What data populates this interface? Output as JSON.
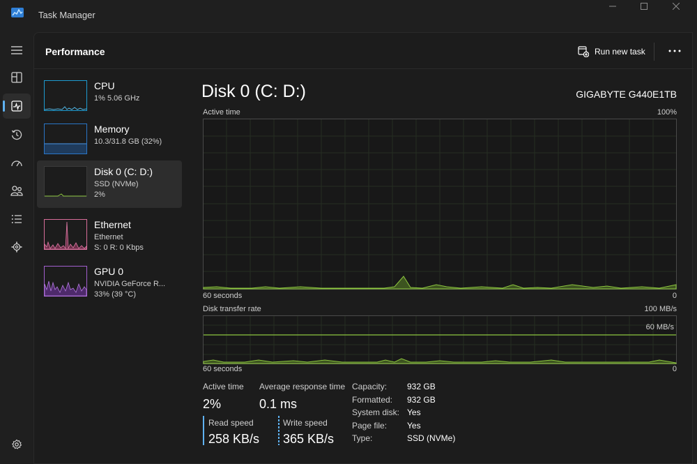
{
  "window": {
    "title": "Task Manager"
  },
  "header": {
    "title": "Performance",
    "run_new_task": "Run new task"
  },
  "nav": {
    "items": [
      {
        "icon": "hamburger-menu-icon"
      },
      {
        "icon": "processes-icon"
      },
      {
        "icon": "performance-icon"
      },
      {
        "icon": "app-history-icon"
      },
      {
        "icon": "startup-apps-icon"
      },
      {
        "icon": "users-icon"
      },
      {
        "icon": "details-icon"
      },
      {
        "icon": "services-icon"
      },
      {
        "icon": "settings-gear-icon"
      }
    ]
  },
  "devices": [
    {
      "name": "CPU",
      "sub1": "1% 5.06 GHz",
      "sub2": "",
      "color": "#1d9bd1"
    },
    {
      "name": "Memory",
      "sub1": "10.3/31.8 GB (32%)",
      "sub2": "",
      "color": "#2a76c8"
    },
    {
      "name": "Disk 0 (C: D:)",
      "sub1": "SSD (NVMe)",
      "sub2": "2%",
      "color": "#8dc63f"
    },
    {
      "name": "Ethernet",
      "sub1": "Ethernet",
      "sub2": "S: 0 R: 0 Kbps",
      "color": "#d86d9a"
    },
    {
      "name": "GPU 0",
      "sub1": "NVIDIA GeForce R...",
      "sub2": "33% (39 °C)",
      "color": "#a35fcf"
    }
  ],
  "disk": {
    "title": "Disk 0 (C: D:)",
    "model": "GIGABYTE G440E1TB"
  },
  "active_chart": {
    "label": "Active time",
    "max_label": "100%",
    "x_left": "60 seconds",
    "x_right": "0"
  },
  "transfer_chart": {
    "label": "Disk transfer rate",
    "max_label": "100 MB/s",
    "marker_label": "60 MB/s",
    "x_left": "60 seconds",
    "x_right": "0"
  },
  "stats": {
    "active_time_label": "Active time",
    "active_time_value": "2%",
    "avg_response_label": "Average response time",
    "avg_response_value": "0.1 ms",
    "read_speed_label": "Read speed",
    "read_speed_value": "258 KB/s",
    "write_speed_label": "Write speed",
    "write_speed_value": "365 KB/s"
  },
  "properties": [
    {
      "key": "Capacity:",
      "value": "932 GB"
    },
    {
      "key": "Formatted:",
      "value": "932 GB"
    },
    {
      "key": "System disk:",
      "value": "Yes"
    },
    {
      "key": "Page file:",
      "value": "Yes"
    },
    {
      "key": "Type:",
      "value": "SSD (NVMe)"
    }
  ],
  "colors": {
    "accent": "#5fb2f2",
    "disk": "#8dc63f",
    "grid": "#2f3a2a",
    "read": "#5fb2f2",
    "write": "#5fb2f2"
  }
}
